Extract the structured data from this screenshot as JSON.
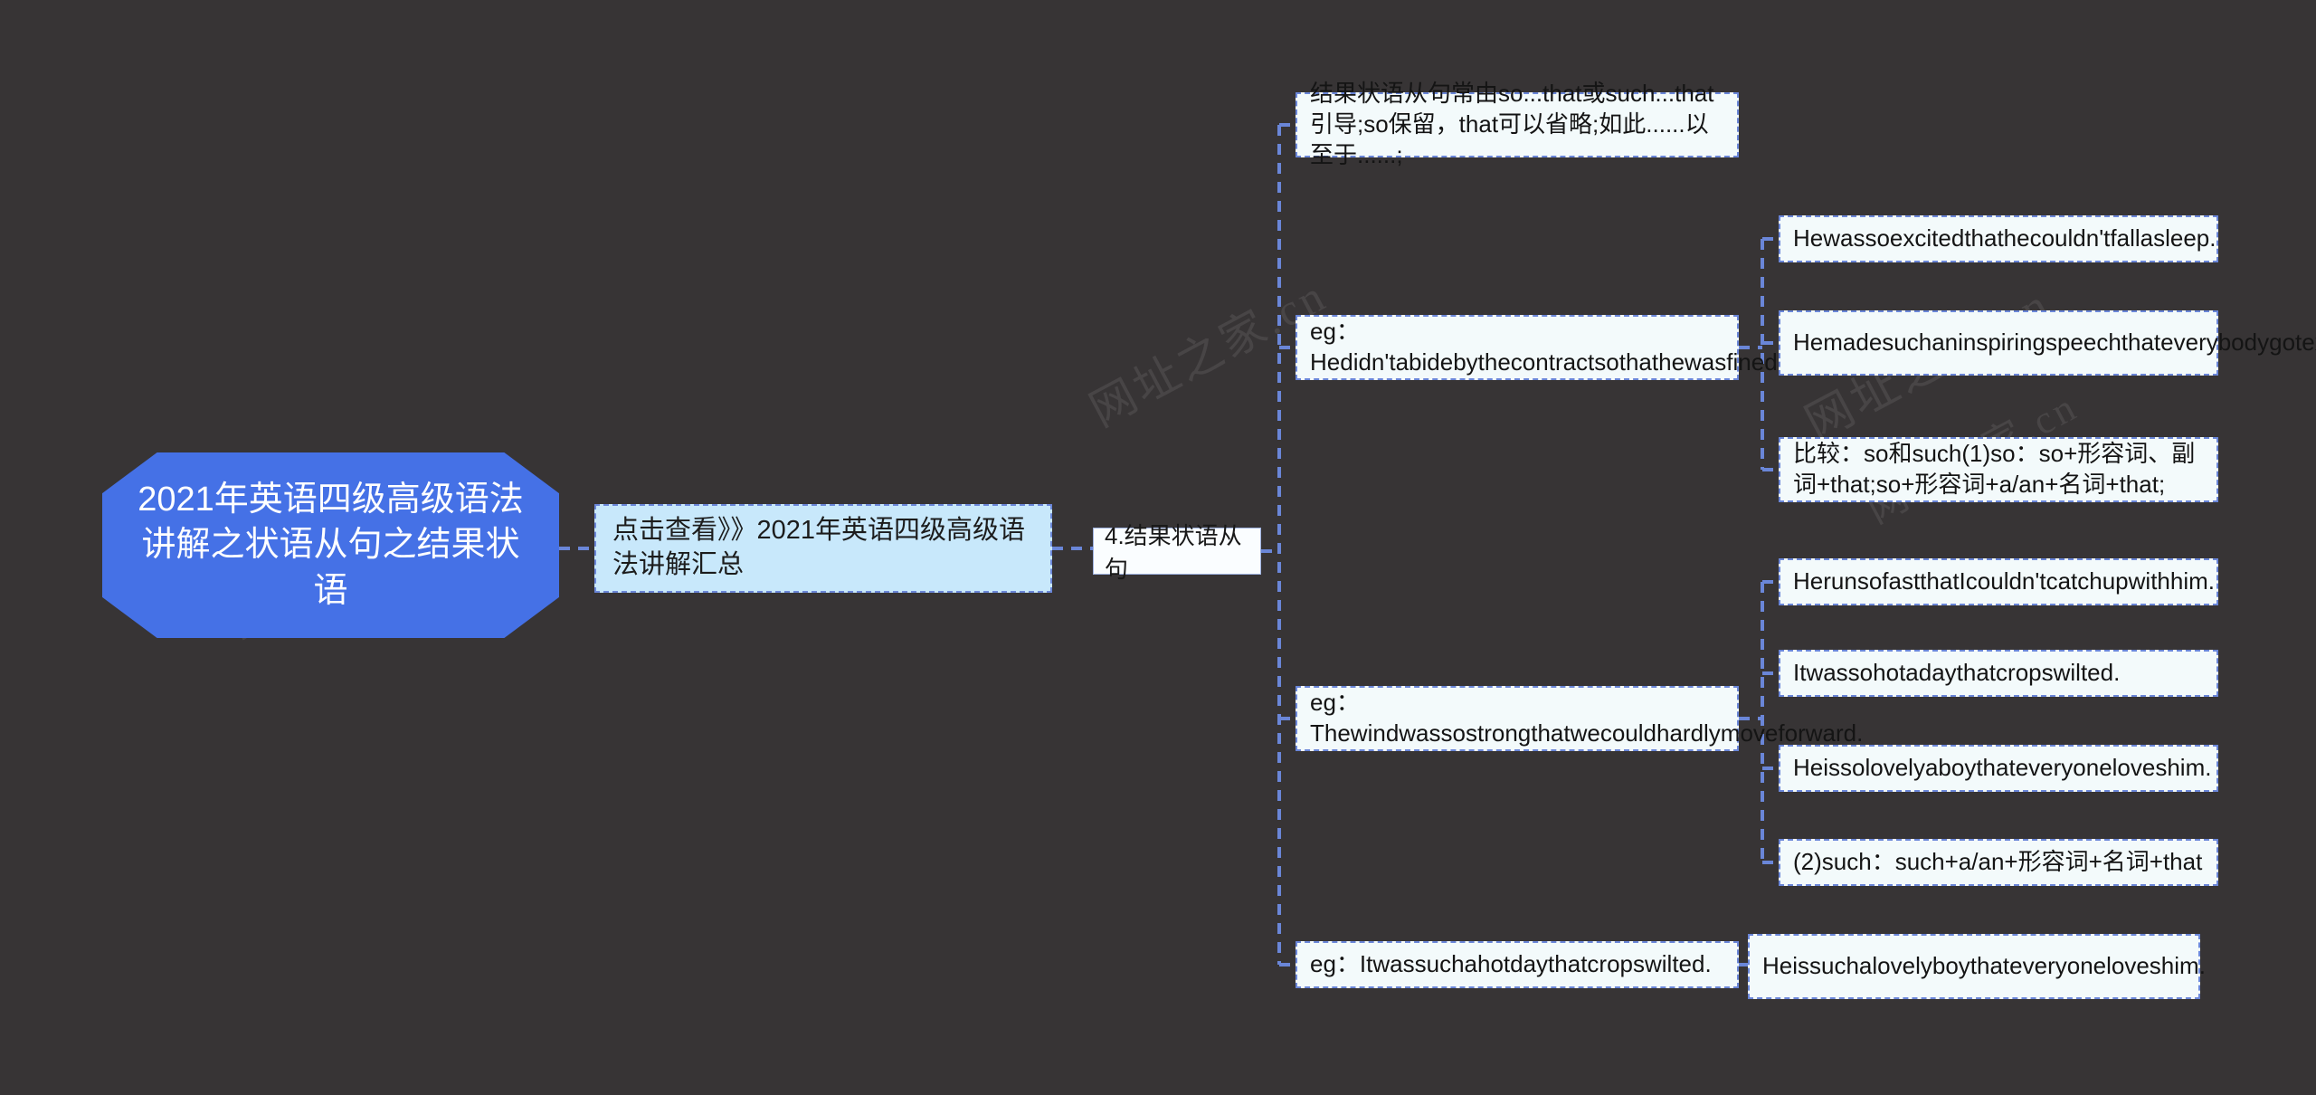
{
  "theme": {
    "background": "#373435",
    "root_fill": "#4571E6",
    "root_text": "#ffffff",
    "level2_fill": "#c8e8fb",
    "leaf_fill": "#f3fafb",
    "border_color": "#6a86d8",
    "line_color": "#6a86d8",
    "text_color": "#141414"
  },
  "watermark": {
    "text": "网址之家.cn"
  },
  "mindmap": {
    "type": "mindmap",
    "root": {
      "label": "2021年英语四级高级语法讲解之状语从句之结果状语",
      "lines": [
        "2021年英语四级高级语法",
        "讲解之状语从句之结果状",
        "语"
      ]
    },
    "level2": {
      "label": "点击查看》》2021年英语四级高级语法讲解汇总"
    },
    "level3": {
      "label": "4.结果状语从句"
    },
    "branches": [
      {
        "label": "结果状语从句常由so...that或such...that引导;so保留，that可以省略;如此......以至于......;",
        "children": []
      },
      {
        "label": "eg：Hedidn'tabidebythecontractsothathewasfined.",
        "children": [
          "Hewassoexcitedthathecouldn'tfallasleep.",
          "Hemadesuchaninspiringspeechthateverybodygotexcited.",
          "比较：so和such(1)so：so+形容词、副词+that;so+形容词+a/an+名词+that;"
        ]
      },
      {
        "label": "eg：Thewindwassostrongthatwecouldhardlymoveforward.",
        "children": [
          "HerunsofastthatIcouldn'tcatchupwithhim.",
          "Itwassohotadaythatcropswilted.",
          "Heissolovelyaboythateveryoneloveshim.",
          "(2)such：such+a/an+形容词+名词+that"
        ]
      },
      {
        "label": "eg：Itwassuchahotdaythatcropswilted.",
        "children": [
          "Heissuchalovelyboythateveryoneloveshim."
        ]
      }
    ]
  }
}
